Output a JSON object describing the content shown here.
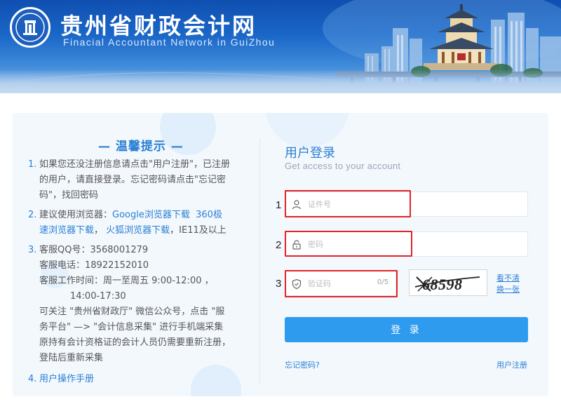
{
  "header": {
    "title": "贵州省财政会计网",
    "subtitle": "Finacial  Accountant  Network  in  GuiZhou"
  },
  "tips": {
    "title": "— 温馨提示 —",
    "items": [
      {
        "num": "1.",
        "lines": [
          "如果您还没注册信息请点击\"用户注册\"，已注册",
          "的用户，请直接登录。忘记密码请点击\"忘记密",
          "码\"，找回密码"
        ]
      },
      {
        "num": "2.",
        "line1_prefix": "建议使用浏览器：",
        "link_google": "Google浏览器下载",
        "link_360_part1": "360极",
        "link_360_part2": "速浏览器下载",
        "link_firefox": "火狐浏览器下载",
        "suffix": "，IE11及以上"
      },
      {
        "num": "3.",
        "lines": [
          "客服QQ号：3568001279",
          "客服电话：18922152010",
          "客服工作时间：周一至周五 9:00-12:00 ，",
          "14:00-17:30",
          "可关注 \"贵州省财政厅\" 微信公众号，点击 \"服",
          "务平台\" —> \"会计信息采集\" 进行手机端采集",
          "原持有会计资格证的会计人员仍需要重新注册，",
          "登陆后重新采集"
        ]
      },
      {
        "num": "4.",
        "link": "用户操作手册"
      }
    ]
  },
  "login": {
    "title": "用户登录",
    "subtitle": "Get access to your account",
    "id_placeholder": "证件号",
    "password_placeholder": "密码",
    "captcha_placeholder": "验证码",
    "captcha_counter": "0/5",
    "captcha_text": "68598",
    "refresh_line1": "看不清",
    "refresh_line2": "换一张",
    "submit": "登 录",
    "forgot": "忘记密码?",
    "register": "用户注册"
  },
  "annotations": {
    "markers": [
      "1",
      "2",
      "3"
    ],
    "box_color": "#e0242b"
  },
  "colors": {
    "accent": "#2a7fd4",
    "button": "#2e9bee",
    "banner": "#1a67c8"
  }
}
